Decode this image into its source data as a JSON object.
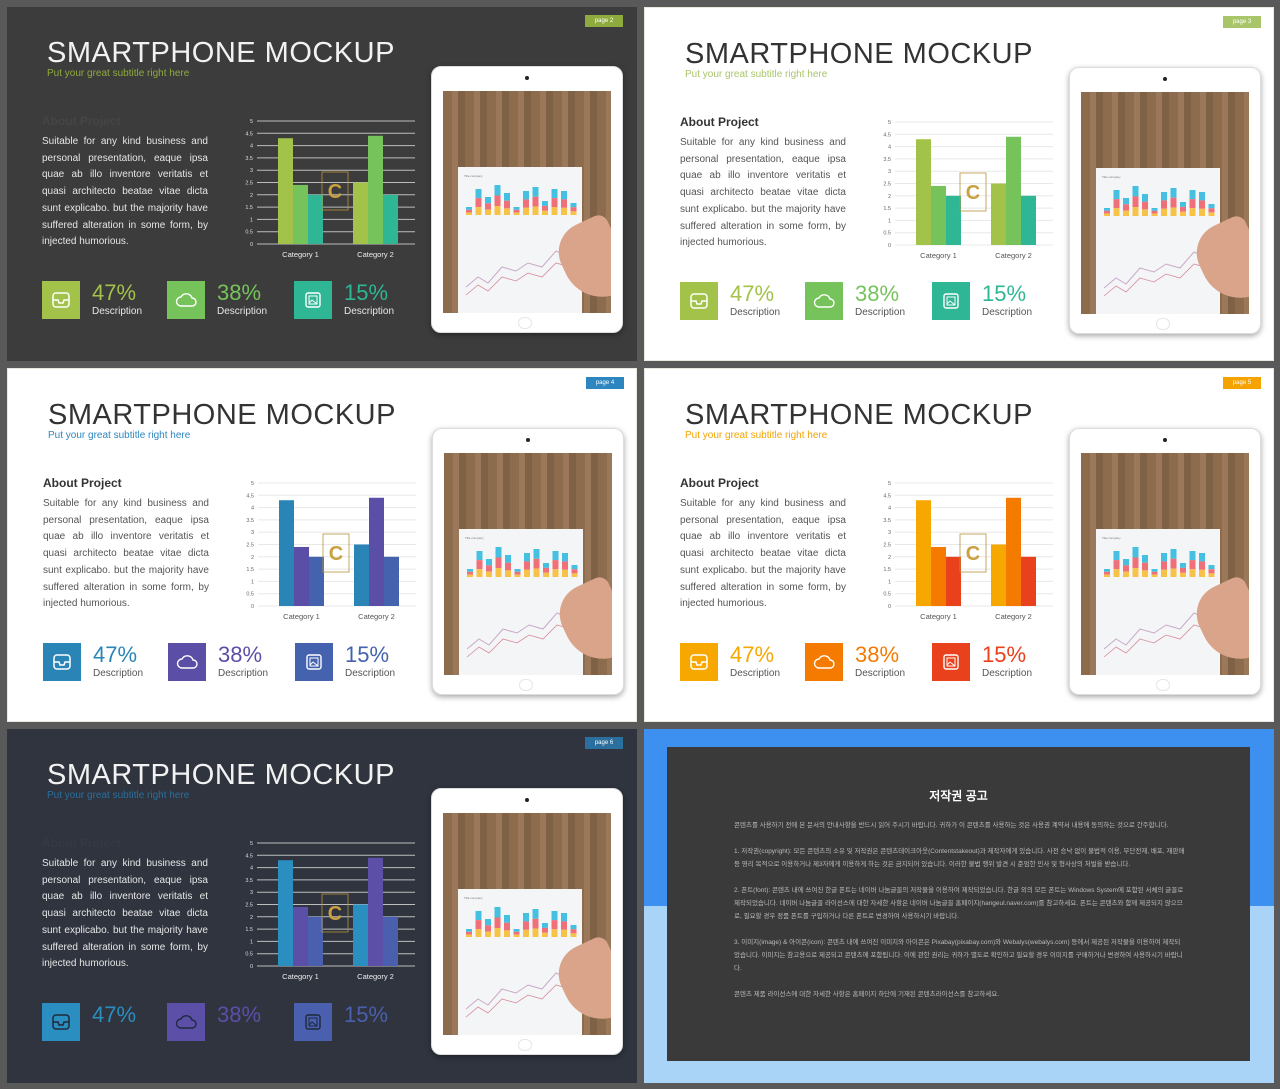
{
  "content": {
    "title": "SMARTPHONE MOCKUP",
    "subtitle": "Put your great subtitle right here",
    "heading": "About Project",
    "paragraph": "Suitable for any kind business and personal presentation, eaque ipsa quae ab illo inventore veritatis et quasi architecto beatae vitae dicta sunt explicabo. but the majority have suffered alteration in some form, by injected humorious.",
    "stats": [
      {
        "value": "47%",
        "label": "Description",
        "icon": "inbox-icon"
      },
      {
        "value": "38%",
        "label": "Description",
        "icon": "cloud-icon"
      },
      {
        "value": "15%",
        "label": "Description",
        "icon": "image-icon"
      }
    ]
  },
  "chart_data": {
    "type": "bar",
    "categories": [
      "Category 1",
      "Category 2"
    ],
    "series": [
      {
        "values": [
          4.3,
          2.5
        ]
      },
      {
        "values": [
          2.4,
          4.4
        ]
      },
      {
        "values": [
          2.0,
          2.0
        ]
      }
    ],
    "yticks": [
      "0",
      "0.5",
      "1",
      "1.5",
      "2",
      "2.5",
      "3",
      "3.5",
      "4",
      "4.5",
      "5"
    ],
    "ylim": [
      0,
      5
    ],
    "grid": true
  },
  "slides": [
    {
      "page": "page 2",
      "bg": "#3c3c3c",
      "dark": true,
      "accent": "#8faa3e",
      "colors": [
        "#a3c24a",
        "#76c35b",
        "#2fb694"
      ],
      "show_desc": true,
      "heading_color": "#454545"
    },
    {
      "page": "page 3",
      "bg": "#ffffff",
      "dark": false,
      "accent": "#a8c56a",
      "colors": [
        "#a3c24a",
        "#76c35b",
        "#2fb694"
      ],
      "show_desc": true
    },
    {
      "page": "page 4",
      "bg": "#ffffff",
      "dark": false,
      "accent": "#2e86c1",
      "colors": [
        "#2a85b6",
        "#5a4ea6",
        "#4462ae"
      ],
      "show_desc": true
    },
    {
      "page": "page 5",
      "bg": "#ffffff",
      "dark": false,
      "accent": "#f5a300",
      "colors": [
        "#f7a800",
        "#f57b00",
        "#e8411c"
      ],
      "show_desc": true
    },
    {
      "page": "page 6",
      "bg": "#2f343e",
      "dark": true,
      "accent": "#2a6f9e",
      "colors": [
        "#2a8ec0",
        "#5c4fa8",
        "#4a5fae"
      ],
      "show_desc": false,
      "heading_color": "#343a44"
    }
  ],
  "notice": {
    "title": "저작권 공고",
    "paragraphs": [
      "콘텐츠를 사용하기 전에 본 문서의 안내사항을 반드시 읽어 주시기 바랍니다. 귀하가 이 콘텐츠를 사용하는 것은 사용권 계약서 내용에 동의하는 것으로 간주합니다.",
      "1. 저작권(copyright): 모든 콘텐츠의 소유 및 저작권은 콘텐츠테이크아웃(Contentstakeout)과 제작자에게 있습니다. 사전 승낙 없이 불법적 이용, 무단전재, 배포, 재판매 등 영리 목적으로 이용하거나 제3자에게 이용하게 하는 것은 금지되어 있습니다. 이러한 불법 행위 발견 시 준엄한 민사 및 형사상의 처벌을 받습니다.",
      "2. 폰트(font): 콘텐츠 내에 쓰여진 한글 폰트는 네이버 나눔글꼴의 저작물을 이용하여 제작되었습니다. 한글 외의 모든 폰트는 Windows System에 포함된 서체의 글꼴로 제작되었습니다. 네이버 나눔글꼴 라이선스에 대한 자세한 사항은 네이버 나눔글꼴 홈페이지(hangeul.naver.com)를 참고하세요. 폰트는 콘텐츠와 함께 제공되지 않으므로, 필요할 경우 정품 폰트를 구입하거나 다른 폰트로 변경하여 사용하시기 바랍니다.",
      "3. 이미지(image) & 아이콘(icon): 콘텐츠 내에 쓰여진 이미지와 아이콘은 Pixabay(pixabay.com)와 Webalys(webalys.com) 등에서 제공된 저작물을 이용하여 제작되었습니다. 이미지는 참고용으로 제공되고 콘텐츠에 포함됩니다. 이에 관한 권리는 귀하가 별도로 확인하고 필요할 경우 이미지를 구매하거나 변경하여 사용하시기 바랍니다.",
      "콘텐츠 제품 라이선스에 대한 자세한 사항은 홈페이지 하단에 기재된 콘텐츠라이선스를 참고하세요."
    ],
    "colors": {
      "top": "#3d8ff0",
      "bottom": "#a9d3f7",
      "panel": "#3a3a3a"
    }
  }
}
